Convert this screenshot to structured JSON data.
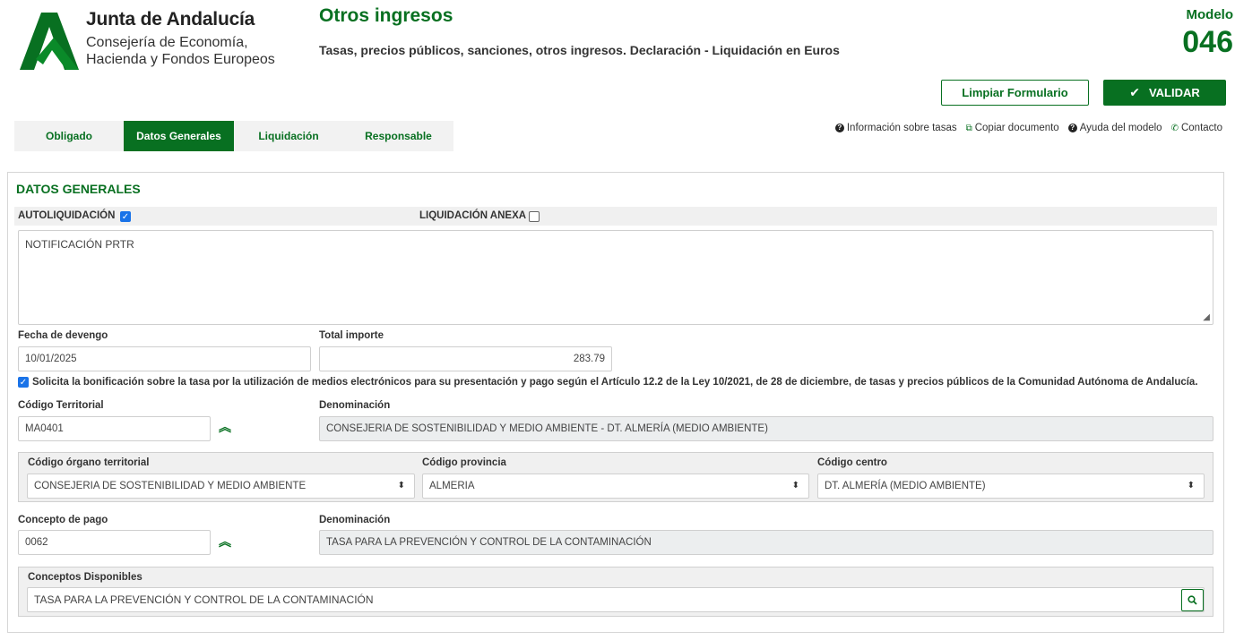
{
  "header": {
    "org_name": "Junta de Andalucía",
    "org_dept_line1": "Consejería de Economía,",
    "org_dept_line2": "Hacienda y Fondos Europeos",
    "title": "Otros ingresos",
    "subtitle": "Tasas, precios públicos, sanciones, otros ingresos. Declaración - Liquidación en Euros",
    "modelo_label": "Modelo",
    "modelo_number": "046",
    "brand_color": "#087021"
  },
  "actions": {
    "clear_label": "Limpiar Formulario",
    "validate_label": "VALIDAR"
  },
  "tabs": [
    {
      "label": "Obligado",
      "active": false
    },
    {
      "label": "Datos Generales",
      "active": true
    },
    {
      "label": "Liquidación",
      "active": false
    },
    {
      "label": "Responsable",
      "active": false
    }
  ],
  "links": [
    {
      "label": "Información sobre tasas",
      "icon": "question-circle-icon"
    },
    {
      "label": "Copiar documento",
      "icon": "copy-icon"
    },
    {
      "label": "Ayuda del modelo",
      "icon": "question-circle-icon"
    },
    {
      "label": "Contacto",
      "icon": "phone-icon"
    }
  ],
  "form": {
    "section_title": "DATOS GENERALES",
    "autoliquidacion_label": "AUTOLIQUIDACIÓN",
    "autoliquidacion_checked": true,
    "liquidacion_anexa_label": "LIQUIDACIÓN ANEXA",
    "liquidacion_anexa_checked": false,
    "description": "NOTIFICACIÓN PRTR",
    "fecha_devengo_label": "Fecha de devengo",
    "fecha_devengo": "10/01/2025",
    "total_importe_label": "Total importe",
    "total_importe": "283.79",
    "bonificacion_checked": true,
    "bonificacion_text": "Solicita la bonificación sobre la tasa por la utilización de medios electrónicos para su presentación y pago según el Artículo 12.2 de la Ley 10/2021, de 28 de diciembre, de tasas y precios públicos de la Comunidad Autónoma de Andalucía.",
    "codigo_territorial_label": "Código Territorial",
    "codigo_territorial": "MA0401",
    "denominacion_label": "Denominación",
    "denominacion_territorial": "CONSEJERIA DE SOSTENIBILIDAD Y MEDIO AMBIENTE - DT. ALMERÍA (MEDIO AMBIENTE)",
    "organo_label": "Código órgano territorial",
    "organo_value": "CONSEJERIA DE SOSTENIBILIDAD Y MEDIO AMBIENTE",
    "provincia_label": "Código provincia",
    "provincia_value": "ALMERIA",
    "centro_label": "Código centro",
    "centro_value": "DT. ALMERÍA (MEDIO AMBIENTE)",
    "concepto_label": "Concepto de pago",
    "concepto_value": "0062",
    "denominacion_concepto_label": "Denominación",
    "denominacion_concepto": "TASA PARA LA PREVENCIÓN Y CONTROL DE LA CONTAMINACIÓN",
    "conceptos_disponibles_label": "Conceptos Disponibles",
    "conceptos_disponibles_value": "TASA PARA LA PREVENCIÓN Y CONTROL DE LA CONTAMINACIÓN"
  }
}
